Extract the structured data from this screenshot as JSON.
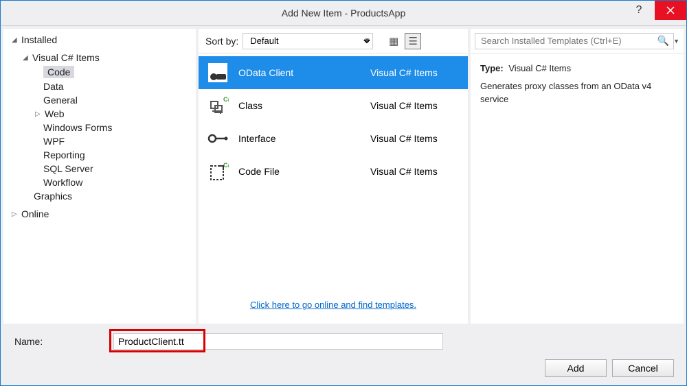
{
  "title": "Add New Item - ProductsApp",
  "tree": {
    "installed": "Installed",
    "csharp_items": "Visual C# Items",
    "code": "Code",
    "data": "Data",
    "general": "General",
    "web": "Web",
    "windows_forms": "Windows Forms",
    "wpf": "WPF",
    "reporting": "Reporting",
    "sql_server": "SQL Server",
    "workflow": "Workflow",
    "graphics": "Graphics",
    "online": "Online"
  },
  "sort": {
    "label": "Sort by:",
    "value": "Default"
  },
  "search": {
    "placeholder": "Search Installed Templates (Ctrl+E)"
  },
  "templates": [
    {
      "name": "OData Client",
      "lang": "Visual C# Items"
    },
    {
      "name": "Class",
      "lang": "Visual C# Items"
    },
    {
      "name": "Interface",
      "lang": "Visual C# Items"
    },
    {
      "name": "Code File",
      "lang": "Visual C# Items"
    }
  ],
  "description": {
    "type_label": "Type:",
    "type_value": "Visual C# Items",
    "text": "Generates proxy classes from an OData v4 service"
  },
  "online_link": "Click here to go online and find templates.",
  "name_field": {
    "label": "Name:",
    "value": "ProductClient.tt"
  },
  "buttons": {
    "add": "Add",
    "cancel": "Cancel"
  }
}
